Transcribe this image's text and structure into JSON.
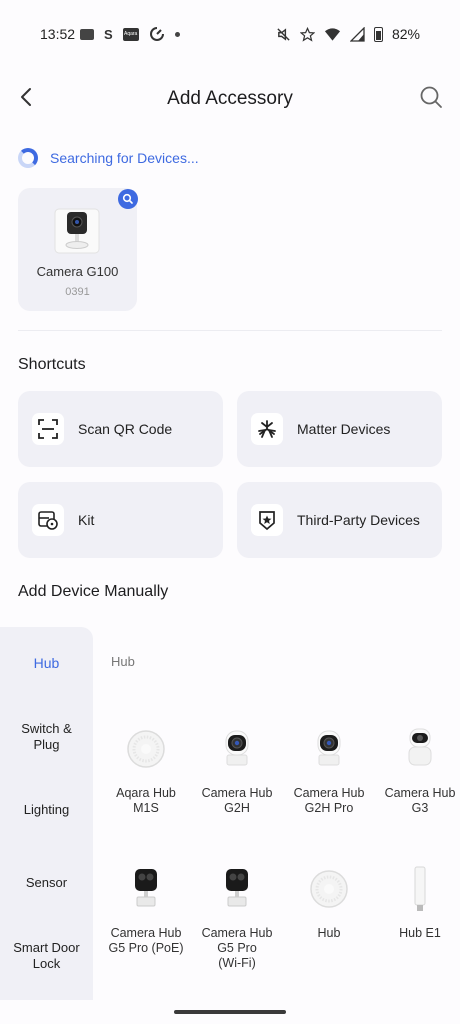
{
  "status_bar": {
    "time": "13:52",
    "battery": "82%",
    "s_glyph": "S",
    "brand_glyph": "Aqara"
  },
  "header": {
    "title": "Add Accessory"
  },
  "searching": {
    "text": "Searching for Devices..."
  },
  "found_device": {
    "name": "Camera G100",
    "code": "0391"
  },
  "shortcuts": {
    "title": "Shortcuts",
    "items": [
      {
        "label": "Scan QR Code",
        "icon": "scan-qr-icon"
      },
      {
        "label": "Matter Devices",
        "icon": "matter-icon"
      },
      {
        "label": "Kit",
        "icon": "kit-icon"
      },
      {
        "label": "Third-Party Devices",
        "icon": "third-party-icon"
      }
    ]
  },
  "manual": {
    "title": "Add Device Manually",
    "categories": [
      {
        "label": "Hub",
        "active": true
      },
      {
        "label": "Switch &\nPlug"
      },
      {
        "label": "Lighting"
      },
      {
        "label": "Sensor"
      },
      {
        "label": "Smart Door\nLock"
      }
    ],
    "panel_heading": "Hub",
    "devices": [
      {
        "label": "Aqara Hub\nM1S",
        "icon": "hub-disc-icon"
      },
      {
        "label": "Camera Hub\nG2H",
        "icon": "camera-dome-icon"
      },
      {
        "label": "Camera Hub\nG2H Pro",
        "icon": "camera-dome-icon"
      },
      {
        "label": "Camera Hub\nG3",
        "icon": "camera-robot-icon"
      },
      {
        "label": "Camera Hub\nG5 Pro (PoE)",
        "icon": "camera-box-icon"
      },
      {
        "label": "Camera Hub\nG5 Pro\n(Wi-Fi)",
        "icon": "camera-box-icon"
      },
      {
        "label": "Hub",
        "icon": "hub-disc-icon"
      },
      {
        "label": "Hub E1",
        "icon": "usb-dongle-icon"
      }
    ]
  },
  "colors": {
    "accent": "#3e6ae1",
    "card_bg": "#f0f0f6"
  }
}
